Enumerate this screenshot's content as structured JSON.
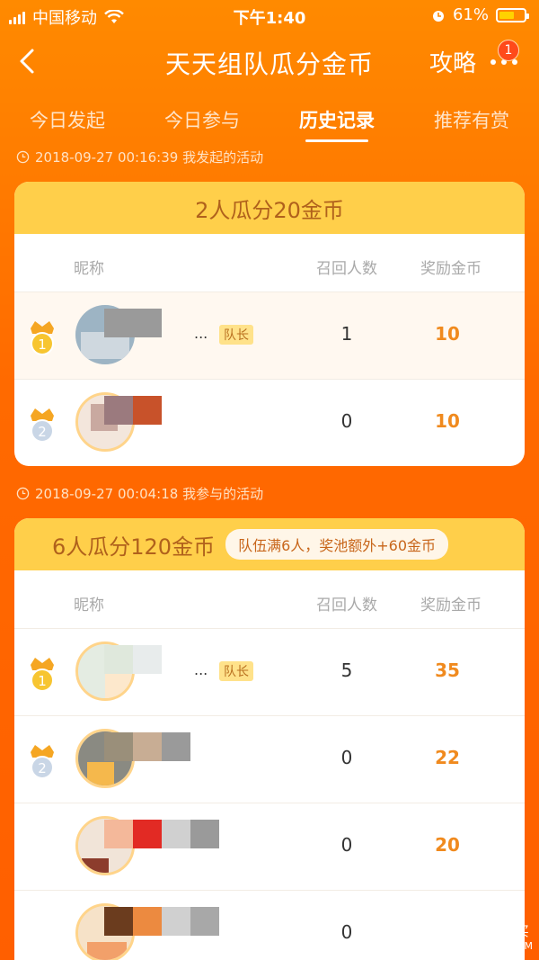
{
  "status_bar": {
    "carrier": "中国移动",
    "time": "下午1:40",
    "battery_percent": "61%",
    "battery_level": 0.61,
    "icons": [
      "signal-icon",
      "wifi-icon",
      "alarm-icon",
      "battery-icon"
    ]
  },
  "nav": {
    "title": "天天组队瓜分金币",
    "guide_label": "攻略",
    "notify_count": "1",
    "icons": [
      "back-icon",
      "more-icon"
    ]
  },
  "tabs": [
    {
      "label": "今日发起",
      "active": false
    },
    {
      "label": "今日参与",
      "active": false
    },
    {
      "label": "历史记录",
      "active": true
    },
    {
      "label": "推荐有赏",
      "active": false
    }
  ],
  "sections": [
    {
      "meta": "2018-09-27 00:16:39 我发起的活动",
      "title": "2人瓜分20金币",
      "bonus": "",
      "columns": {
        "nick": "昵称",
        "recall": "召回人数",
        "reward": "奖励金币"
      },
      "rows": [
        {
          "rank": "1",
          "nick_suffix": "...",
          "leader": "队长",
          "recall": "1",
          "reward": "10"
        },
        {
          "rank": "2",
          "nick_suffix": "",
          "leader": "",
          "recall": "0",
          "reward": "10"
        }
      ]
    },
    {
      "meta": "2018-09-27 00:04:18 我参与的活动",
      "title": "6人瓜分120金币",
      "bonus": "队伍满6人，奖池额外+60金币",
      "columns": {
        "nick": "昵称",
        "recall": "召回人数",
        "reward": "奖励金币"
      },
      "rows": [
        {
          "rank": "1",
          "nick_suffix": "...",
          "leader": "队长",
          "recall": "5",
          "reward": "35"
        },
        {
          "rank": "2",
          "nick_suffix": "",
          "leader": "",
          "recall": "0",
          "reward": "22"
        },
        {
          "rank": "",
          "nick_suffix": "",
          "leader": "",
          "recall": "0",
          "reward": "20"
        },
        {
          "rank": "",
          "nick_suffix": "",
          "leader": "",
          "recall": "0",
          "reward": ""
        }
      ]
    }
  ],
  "colors": {
    "background": "#ff7400",
    "card_header": "#ffcf4a",
    "reward": "#f08a1e",
    "leader_badge": "#ffe28a"
  },
  "watermark": {
    "title": "什么值得买",
    "subtitle": "SMZDM.COM"
  }
}
